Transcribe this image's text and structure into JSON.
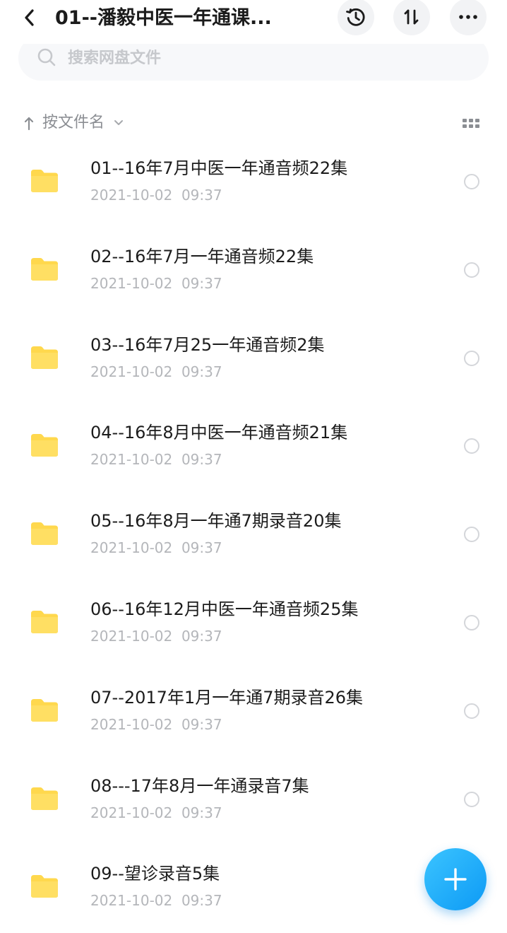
{
  "header": {
    "title": "01--潘毅中医一年通课...",
    "back_icon": "chevron-left-icon",
    "history_icon": "history-clock-icon",
    "sort_icon": "sort-arrows-icon",
    "more_icon": "more-dots-icon"
  },
  "search": {
    "placeholder": "搜索网盘文件",
    "icon": "search-icon"
  },
  "sortbar": {
    "label": "按文件名",
    "direction": "ascending",
    "view_icon": "grid-view-icon"
  },
  "files": [
    {
      "name": "01--16年7月中医一年通音频22集",
      "time": "2021-10-02  09:37",
      "type": "folder"
    },
    {
      "name": "02--16年7月一年通音频22集",
      "time": "2021-10-02  09:37",
      "type": "folder"
    },
    {
      "name": "03--16年7月25一年通音频2集",
      "time": "2021-10-02  09:37",
      "type": "folder"
    },
    {
      "name": "04--16年8月中医一年通音频21集",
      "time": "2021-10-02  09:37",
      "type": "folder"
    },
    {
      "name": "05--16年8月一年通7期录音20集",
      "time": "2021-10-02  09:37",
      "type": "folder"
    },
    {
      "name": "06--16年12月中医一年通音频25集",
      "time": "2021-10-02  09:37",
      "type": "folder"
    },
    {
      "name": "07--2017年1月一年通7期录音26集",
      "time": "2021-10-02  09:37",
      "type": "folder"
    },
    {
      "name": "08---17年8月一年通录音7集",
      "time": "2021-10-02  09:37",
      "type": "folder"
    },
    {
      "name": "09--望诊录音5集",
      "time": "2021-10-02  09:37",
      "type": "folder"
    }
  ],
  "fab": {
    "icon": "plus-icon"
  },
  "colors": {
    "folder": "#ffd84d",
    "accent": "#1aa6ff",
    "muted_text": "#b4b6ba"
  }
}
